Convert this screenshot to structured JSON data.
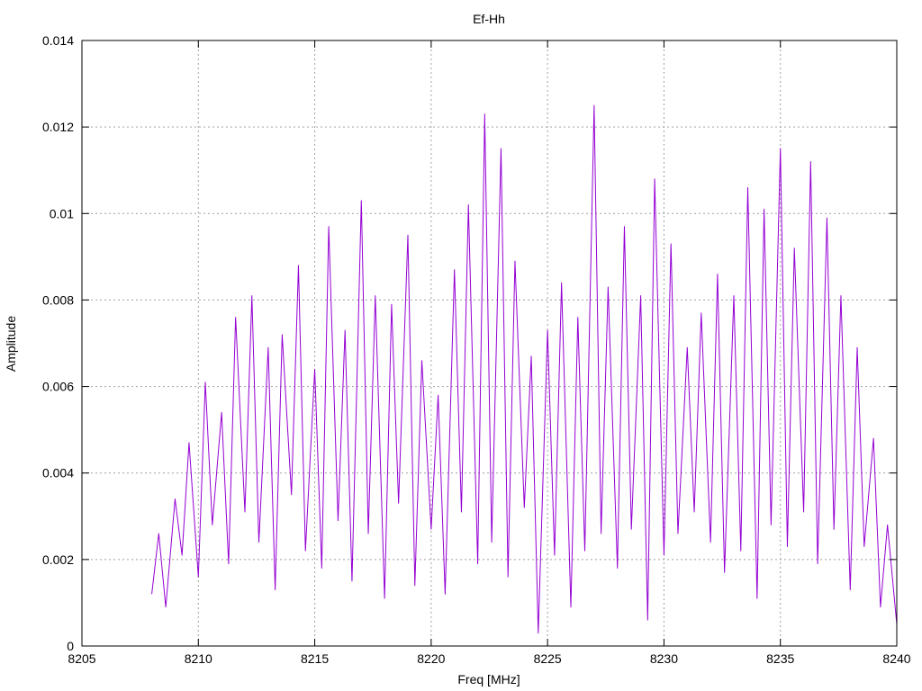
{
  "chart_data": {
    "type": "line",
    "title": "Ef-Hh",
    "xlabel": "Freq [MHz]",
    "ylabel": "Amplitude",
    "xlim": [
      8205,
      8240
    ],
    "ylim": [
      0,
      0.014
    ],
    "x_ticks": [
      8205,
      8210,
      8215,
      8220,
      8225,
      8230,
      8235,
      8240
    ],
    "x_tick_labels": [
      "8205",
      "8210",
      "8215",
      "8220",
      "8225",
      "8230",
      "8235",
      "8240"
    ],
    "y_ticks": [
      0,
      0.002,
      0.004,
      0.006,
      0.008,
      0.01,
      0.012,
      0.014
    ],
    "y_tick_labels": [
      "0",
      "0.002",
      "0.004",
      "0.006",
      "0.008",
      "0.01",
      "0.012",
      "0.014"
    ],
    "grid": true,
    "legend": "none",
    "series": [
      {
        "color": "#9400d3",
        "x": [
          8208.0,
          8208.3,
          8208.6,
          8209.0,
          8209.3,
          8209.6,
          8210.0,
          8210.3,
          8210.6,
          8211.0,
          8211.3,
          8211.6,
          8212.0,
          8212.3,
          8212.6,
          8213.0,
          8213.3,
          8213.6,
          8214.0,
          8214.3,
          8214.6,
          8215.0,
          8215.3,
          8215.6,
          8216.0,
          8216.3,
          8216.6,
          8217.0,
          8217.3,
          8217.6,
          8218.0,
          8218.3,
          8218.6,
          8219.0,
          8219.3,
          8219.6,
          8220.0,
          8220.3,
          8220.6,
          8221.0,
          8221.3,
          8221.6,
          8222.0,
          8222.3,
          8222.6,
          8223.0,
          8223.3,
          8223.6,
          8224.0,
          8224.3,
          8224.6,
          8225.0,
          8225.3,
          8225.6,
          8226.0,
          8226.3,
          8226.6,
          8227.0,
          8227.3,
          8227.6,
          8228.0,
          8228.3,
          8228.6,
          8229.0,
          8229.3,
          8229.6,
          8230.0,
          8230.3,
          8230.6,
          8231.0,
          8231.3,
          8231.6,
          8232.0,
          8232.3,
          8232.6,
          8233.0,
          8233.3,
          8233.6,
          8234.0,
          8234.3,
          8234.6,
          8235.0,
          8235.3,
          8235.6,
          8236.0,
          8236.3,
          8236.6,
          8237.0,
          8237.3,
          8237.6,
          8238.0,
          8238.3,
          8238.6,
          8239.0,
          8239.3,
          8239.6,
          8240.0
        ],
        "y": [
          0.0012,
          0.0026,
          0.0009,
          0.0034,
          0.0021,
          0.0047,
          0.0016,
          0.0061,
          0.0028,
          0.0054,
          0.0019,
          0.0076,
          0.0031,
          0.0081,
          0.0024,
          0.0069,
          0.0013,
          0.0072,
          0.0035,
          0.0088,
          0.0022,
          0.0064,
          0.0018,
          0.0097,
          0.0029,
          0.0073,
          0.0015,
          0.0103,
          0.0026,
          0.0081,
          0.0011,
          0.0079,
          0.0033,
          0.0095,
          0.0014,
          0.0066,
          0.0027,
          0.0058,
          0.0012,
          0.0087,
          0.0031,
          0.0102,
          0.0019,
          0.0123,
          0.0024,
          0.0115,
          0.0016,
          0.0089,
          0.0032,
          0.0067,
          0.0003,
          0.0073,
          0.0021,
          0.0084,
          0.0009,
          0.0076,
          0.0022,
          0.0125,
          0.0026,
          0.0083,
          0.0018,
          0.0097,
          0.0027,
          0.0081,
          0.0006,
          0.0108,
          0.0021,
          0.0093,
          0.0026,
          0.0069,
          0.0031,
          0.0077,
          0.0024,
          0.0086,
          0.0017,
          0.0081,
          0.0022,
          0.0106,
          0.0011,
          0.0101,
          0.0028,
          0.0115,
          0.0023,
          0.0092,
          0.0031,
          0.0112,
          0.0019,
          0.0099,
          0.0027,
          0.0081,
          0.0013,
          0.0069,
          0.0023,
          0.0048,
          0.0009,
          0.0028,
          0.0005
        ]
      }
    ]
  }
}
